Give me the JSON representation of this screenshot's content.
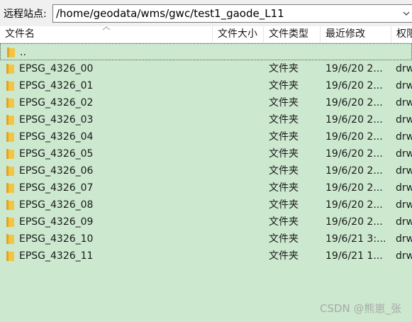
{
  "address": {
    "label": "远程站点:",
    "value": "/home/geodata/wms/gwc/test1_gaode_L11"
  },
  "columns": {
    "name": "文件名",
    "size": "文件大小",
    "type": "文件类型",
    "modified": "最近修改",
    "permissions": "权限"
  },
  "parent_row": {
    "name": ".."
  },
  "rows": [
    {
      "name": "EPSG_4326_00",
      "type": "文件夹",
      "modified": "19/6/20 2...",
      "permissions": "drw"
    },
    {
      "name": "EPSG_4326_01",
      "type": "文件夹",
      "modified": "19/6/20 2...",
      "permissions": "drw"
    },
    {
      "name": "EPSG_4326_02",
      "type": "文件夹",
      "modified": "19/6/20 2...",
      "permissions": "drw"
    },
    {
      "name": "EPSG_4326_03",
      "type": "文件夹",
      "modified": "19/6/20 2...",
      "permissions": "drw"
    },
    {
      "name": "EPSG_4326_04",
      "type": "文件夹",
      "modified": "19/6/20 2...",
      "permissions": "drw"
    },
    {
      "name": "EPSG_4326_05",
      "type": "文件夹",
      "modified": "19/6/20 2...",
      "permissions": "drw"
    },
    {
      "name": "EPSG_4326_06",
      "type": "文件夹",
      "modified": "19/6/20 2...",
      "permissions": "drw"
    },
    {
      "name": "EPSG_4326_07",
      "type": "文件夹",
      "modified": "19/6/20 2...",
      "permissions": "drw"
    },
    {
      "name": "EPSG_4326_08",
      "type": "文件夹",
      "modified": "19/6/20 2...",
      "permissions": "drw"
    },
    {
      "name": "EPSG_4326_09",
      "type": "文件夹",
      "modified": "19/6/20 2...",
      "permissions": "drw"
    },
    {
      "name": "EPSG_4326_10",
      "type": "文件夹",
      "modified": "19/6/21 3:...",
      "permissions": "drw"
    },
    {
      "name": "EPSG_4326_11",
      "type": "文件夹",
      "modified": "19/6/21 1...",
      "permissions": "drw"
    }
  ],
  "icons": {
    "folder": "folder-icon",
    "dropdown": "chevron-down-icon",
    "sort": "sort-ascending-icon"
  },
  "colors": {
    "list_background": "#cce8cf",
    "folder_yellow": "#f4c542"
  },
  "watermark": "CSDN @熊崽_张"
}
